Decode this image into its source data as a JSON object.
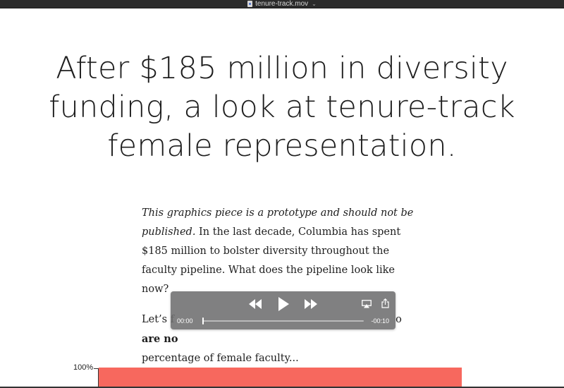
{
  "window": {
    "title": "tenure-track.mov",
    "file_icon": "movie-file-icon",
    "title_menu_icon": "chevron-down-icon"
  },
  "article": {
    "headline_lines": [
      "After $185 million in diversity",
      "funding, a look at tenure-track",
      "female representation."
    ],
    "paragraph1": {
      "italic": "This graphics piece is a prototype and should not be published.",
      "text": " In the last decade, Columbia has spent $185 million to bolster diversity throughout the faculty pipeline. What does the pipeline look like now?"
    },
    "paragraph2": {
      "lead": "Let’s f",
      "trailing": "o",
      "bold": "are no",
      "line3": "percentage of female faculty..."
    }
  },
  "chart_data": {
    "type": "bar",
    "tick_labels": [
      "100%"
    ],
    "colors": {
      "bar": "#f7685e"
    }
  },
  "video_controls": {
    "elapsed": "00:00",
    "remaining": "-00:10",
    "progress": 0.0,
    "icons": {
      "rewind": "rewind-icon",
      "play": "play-icon",
      "fast_forward": "fast-forward-icon",
      "airplay": "airplay-icon",
      "share": "share-icon"
    }
  }
}
